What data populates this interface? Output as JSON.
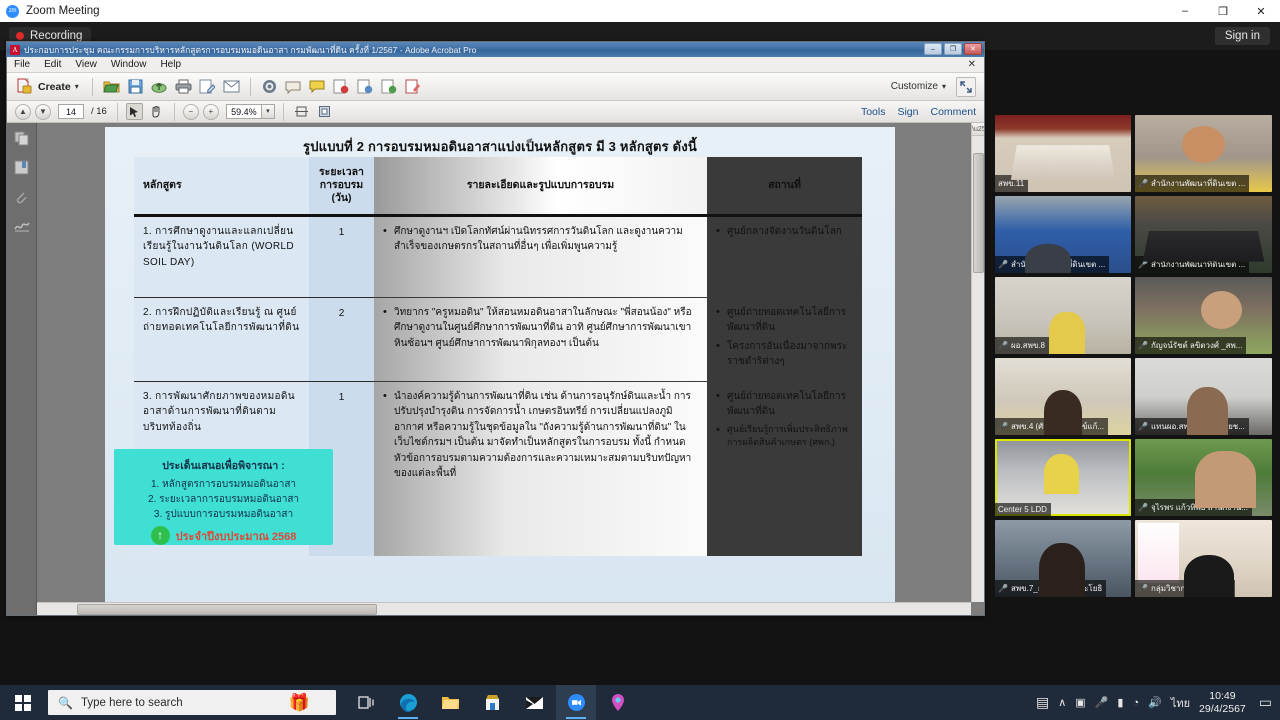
{
  "zoom_window": {
    "title": "Zoom Meeting",
    "logo_text": "zm",
    "recording_label": "Recording",
    "sign_in_label": "Sign in",
    "window_controls": {
      "minimize": "–",
      "maximize": "❐",
      "close": "✕"
    }
  },
  "acrobat": {
    "title": "ประกอบการประชุม คณะกรรมการบริหารหลักสูตรการอบรมหมอดินอาสา กรมพัฒนาที่ดิน ครั้งที่ 1/2567 - Adobe Acrobat Pro",
    "app_icon_text": "A",
    "window_controls": {
      "minimize": "–",
      "restore": "❐",
      "close": "✕",
      "menu_close": "✕"
    },
    "menu": [
      "File",
      "Edit",
      "View",
      "Window",
      "Help"
    ],
    "toolbar": {
      "create_label": "Create",
      "create_caret": "▾",
      "customize_label": "Customize",
      "customize_caret": "▾",
      "icons": [
        "open-file-icon",
        "save-icon",
        "upload-cloud-icon",
        "print-icon",
        "edit-pdf-icon",
        "email-icon",
        "tools-gear-icon",
        "comment-bubble-icon",
        "sticky-note-icon",
        "export-pdf-icon",
        "create-pdf-icon",
        "combine-files-icon",
        "sign-form-icon"
      ],
      "expand_icon": "expand-icon"
    },
    "nav": {
      "prev_icon": "▲",
      "next_icon": "▼",
      "current_page": "14",
      "total_pages": "/ 16",
      "select_tool_icon": "cursor-select-icon",
      "hand_tool_icon": "hand-pan-icon",
      "zoom_out_icon": "−",
      "zoom_in_icon": "+",
      "zoom_level": "59.4%",
      "zoom_dropdown_caret": "▾",
      "fit_width_icon": "fit-width-icon",
      "fit_page_icon": "fit-page-icon",
      "right_items": [
        "Tools",
        "Sign",
        "Comment"
      ]
    },
    "sidebar_icons": [
      "page-thumbnails-icon",
      "bookmarks-icon",
      "attachments-icon",
      "signatures-icon"
    ]
  },
  "slide": {
    "title": "รูปแบบที่ 2 การอบรมหมอดินอาสาแบ่งเป็นหลักสูตร มี 3 หลักสูตร  ดังนี้",
    "columns": [
      "หลักสูตร",
      "ระยะเวลา\nการอบรม\n(วัน)",
      "รายละเอียดและรูปแบบการอบรม",
      "สถานที่"
    ],
    "column_headers": {
      "c1": "หลักสูตร",
      "c2_line1": "ระยะเวลา",
      "c2_line2": "การอบรม",
      "c2_line3": "(วัน)",
      "c3": "รายละเอียดและรูปแบบการอบรม",
      "c4": "สถานที่"
    },
    "rows": [
      {
        "course": "1. การศึกษาดูงานและแลกเปลี่ยนเรียนรู้ในงานวันดินโลก (WORLD SOIL DAY)",
        "duration": "1",
        "details": [
          "ศึกษาดูงานฯ เปิดโลกทัศน์ผ่านนิทรรศการวันดินโลก และดูงานความสำเร็จของเกษตรกรในสถานที่อื่นๆ เพื่อเพิ่มพูนความรู้"
        ],
        "venues": [
          "ศูนย์กลางจัดงานวันดินโลก"
        ]
      },
      {
        "course": "2. การฝึกปฏิบัติและเรียนรู้ ณ ศูนย์ถ่ายทอดเทคโนโลยีการพัฒนาที่ดิน",
        "duration": "2",
        "details": [
          "วิทยากร \"ครูหมอดิน\" ให้สอนหมอดินอาสาในลักษณะ \"พี่สอนน้อง\" หรือศึกษาดูงานในศูนย์ศึกษาการพัฒนาที่ดิน อาทิ ศูนย์ศึกษาการพัฒนาเขาหินซ้อนฯ ศูนย์ศึกษาการพัฒนาพิกุลทองฯ เป็นต้น"
        ],
        "venues": [
          "ศูนย์ถ่ายทอดเทคโนโลยีการพัฒนาที่ดิน",
          "โครงการอันเนื่องมาจากพระราชดำริต่างๆ"
        ]
      },
      {
        "course": "3.  การพัฒนาศักยภาพของหมอดินอาสาด้านการพัฒนาที่ดินตามบริบทท้องถิ่น",
        "duration": "1",
        "details": [
          "นำองค์ความรู้ด้านการพัฒนาที่ดิน เช่น ด้านการอนุรักษ์ดินและน้ำ การปรับปรุงบำรุงดิน การจัดการน้ำ เกษตรอินทรีย์ การเปลี่ยนแปลงภูมิอากาศ หรือความรู้ในชุดข้อมูลใน \"ถังความรู้ด้านการพัฒนาที่ดิน\" ในเว็บไซต์กรมฯ เป็นต้น มาจัดทำเป็นหลักสูตรในการอบรม ทั้งนี้ กำหนดหัวข้อการอบรมตามความต้องการและความเหมาะสมตามบริบทปัญหาของแต่ละพื้นที่"
        ],
        "venues": [
          "ศูนย์ถ่ายทอดเทคโนโลยีการพัฒนาที่ดิน",
          "ศูนย์เรียนรู้การเพิ่มประสิทธิภาพการผลิตสินค้าเกษตร (ศพก.)"
        ]
      }
    ],
    "callout": {
      "heading": "ประเด็นเสนอเพื่อพิจารณา :",
      "items": [
        "1. หลักสูตรการอบรมหมอดินอาสา",
        "2. ระยะเวลาการอบรมหมอดินอาสา",
        "3. รูปแบบการอบรมหมอดินอาสา"
      ],
      "footer_icon": "↑",
      "footer_text": "ประจำปีงบประมาณ 2568",
      "bg_color": "#3fdfd3",
      "footer_color": "#e0483a"
    }
  },
  "participants": [
    {
      "name": "สพข.11",
      "muted": false,
      "video": "v-room1"
    },
    {
      "name": "สำนักงานพัฒนาที่ดินเขต ...",
      "muted": true,
      "video": "v-man-yellow"
    },
    {
      "name": "สำนักงานพัฒนาที่ดินเขต ...",
      "muted": true,
      "video": "v-blue"
    },
    {
      "name": "สำนักงานพัฒนาที่ดินเขต ...",
      "muted": true,
      "video": "v-room2"
    },
    {
      "name": "ผอ.สพข.8",
      "muted": true,
      "video": "v-office"
    },
    {
      "name": "กัญจน์รัชต์ ลขิตวงศ์ _สพ...",
      "muted": true,
      "video": "v-green-man"
    },
    {
      "name": "สพข.4 (ศัญญาพร สังข์แก้...",
      "muted": true,
      "video": "v-woman1"
    },
    {
      "name": "แทนผอ.สพข.10(นายชัยช...",
      "muted": true,
      "video": "v-man-dark"
    },
    {
      "name": "Center 5 LDD",
      "muted": false,
      "video": "v-center5",
      "active": true
    },
    {
      "name": "จุไรพร แก้วทิพย์ สำนักงาน...",
      "muted": true,
      "video": "v-field"
    },
    {
      "name": "สพข.7_สุนีย์รัตน์ ไลหะโยธิ",
      "muted": true,
      "video": "v-woman2"
    },
    {
      "name": "กลุ่มวิชาการฯ (สพข. 2)",
      "muted": true,
      "video": "v-poster"
    }
  ],
  "taskbar": {
    "start_icon": "windows-start-icon",
    "search_placeholder": "Type here to search",
    "search_icon": "search-icon",
    "gifts_icon": "🎁",
    "apps": [
      {
        "name": "task-view-icon",
        "glyph": "⧉"
      },
      {
        "name": "microsoft-edge-icon",
        "glyph": "◕"
      },
      {
        "name": "file-explorer-icon",
        "glyph": "📁"
      },
      {
        "name": "microsoft-store-icon",
        "glyph": "🛍"
      },
      {
        "name": "mail-icon",
        "glyph": "✉"
      },
      {
        "name": "zoom-app-icon",
        "glyph": "zoom"
      },
      {
        "name": "gps-map-icon",
        "glyph": "📍"
      }
    ],
    "tray": {
      "news_icon": "▤",
      "chevron_icon": "∧",
      "camera_icon": "▣",
      "mic_icon": "ᴘ",
      "battery_icon": "▬",
      "wifi_icon": "◠",
      "volume_icon": "♪",
      "language": "ไทย",
      "time": "10:49",
      "date": "29/4/2567",
      "notification_icon": "▭"
    }
  }
}
